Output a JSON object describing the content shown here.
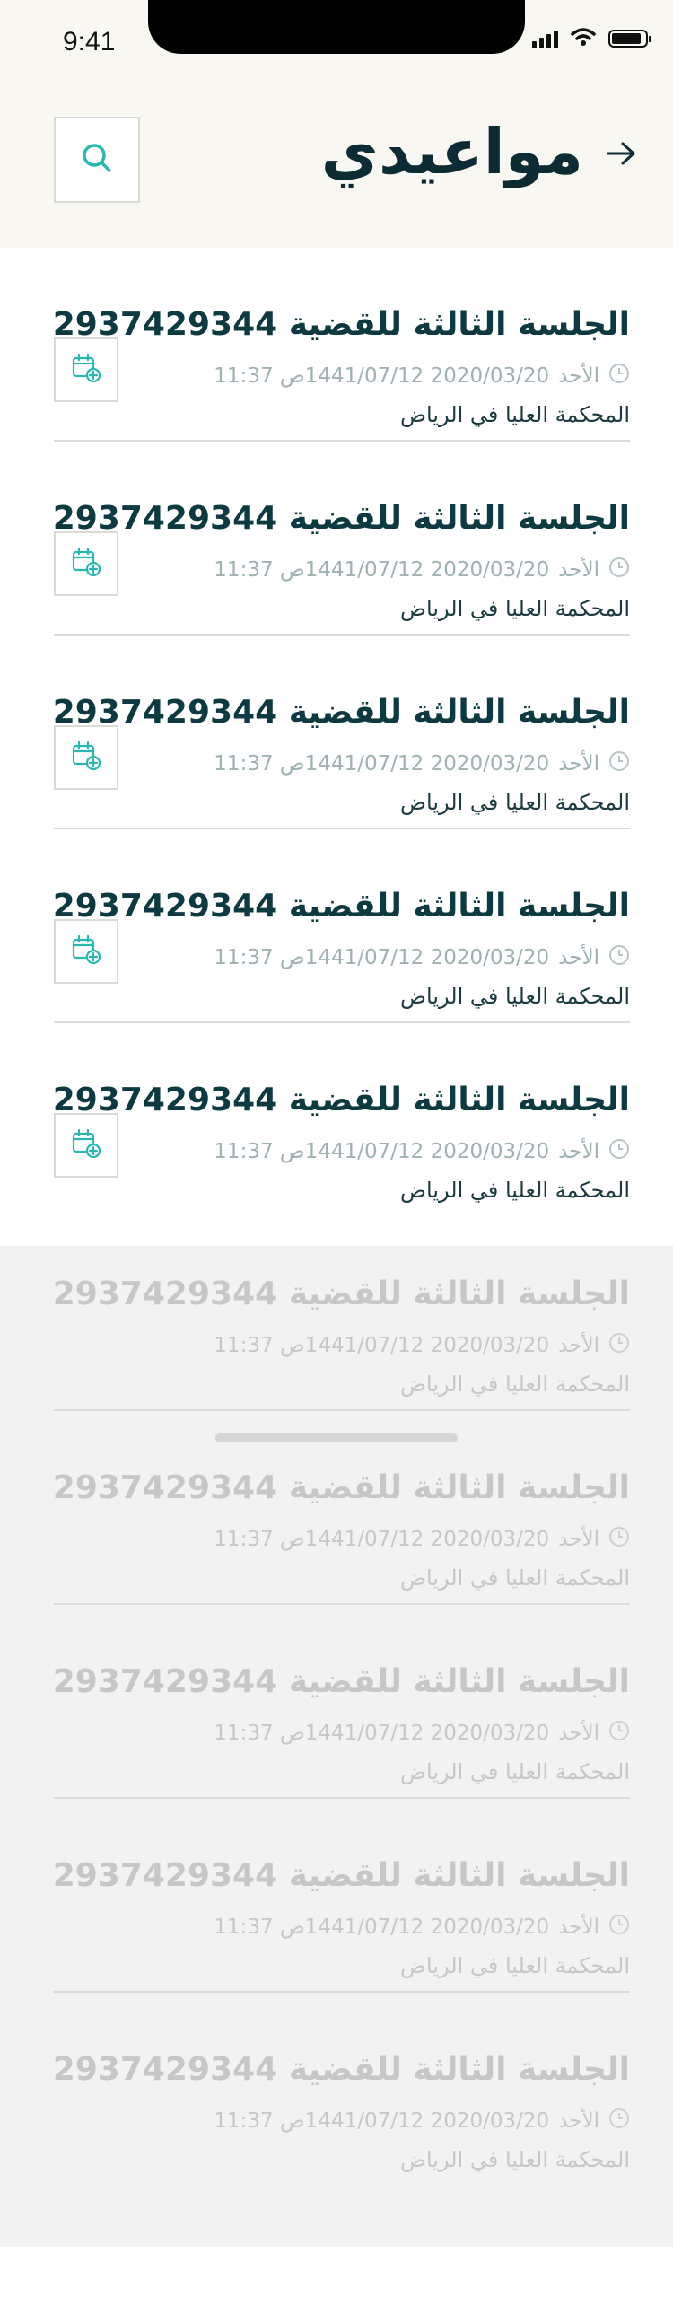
{
  "status_bar": {
    "time": "9:41"
  },
  "header": {
    "title": "مواعيدي",
    "back_icon": "arrow-right-icon",
    "search_icon": "search-icon"
  },
  "colors": {
    "accent": "#2ab7b0",
    "title": "#0d2b33",
    "header_bg": "#f8f7f2"
  },
  "appointments": [
    {
      "title": "الجلسة الثالثة للقضية 2937429344",
      "day": "الأحد",
      "datetime": "2020/03/20 1441/07/12ص 11:37",
      "court": "المحكمة العليا في الرياض"
    },
    {
      "title": "الجلسة الثالثة للقضية 2937429344",
      "day": "الأحد",
      "datetime": "2020/03/20 1441/07/12ص 11:37",
      "court": "المحكمة العليا في الرياض"
    },
    {
      "title": "الجلسة الثالثة للقضية 2937429344",
      "day": "الأحد",
      "datetime": "2020/03/20 1441/07/12ص 11:37",
      "court": "المحكمة العليا في الرياض"
    },
    {
      "title": "الجلسة الثالثة للقضية 2937429344",
      "day": "الأحد",
      "datetime": "2020/03/20 1441/07/12ص 11:37",
      "court": "المحكمة العليا في الرياض"
    },
    {
      "title": "الجلسة الثالثة للقضية 2937429344",
      "day": "الأحد",
      "datetime": "2020/03/20 1441/07/12ص 11:37",
      "court": "المحكمة العليا في الرياض"
    },
    {
      "title": "الجلسة الثالثة للقضية 2937429344",
      "day": "الأحد",
      "datetime": "2020/03/20 1441/07/12ص 11:37",
      "court": "المحكمة العليا في الرياض"
    },
    {
      "title": "الجلسة الثالثة للقضية 2937429344",
      "day": "الأحد",
      "datetime": "2020/03/20 1441/07/12ص 11:37",
      "court": "المحكمة العليا في الرياض"
    },
    {
      "title": "الجلسة الثالثة للقضية 2937429344",
      "day": "الأحد",
      "datetime": "2020/03/20 1441/07/12ص 11:37",
      "court": "المحكمة العليا في الرياض"
    },
    {
      "title": "الجلسة الثالثة للقضية 2937429344",
      "day": "الأحد",
      "datetime": "2020/03/20 1441/07/12ص 11:37",
      "court": "المحكمة العليا في الرياض"
    },
    {
      "title": "الجلسة الثالثة للقضية 2937429344",
      "day": "الأحد",
      "datetime": "2020/03/20 1441/07/12ص 11:37",
      "court": "المحكمة العليا في الرياض"
    }
  ]
}
